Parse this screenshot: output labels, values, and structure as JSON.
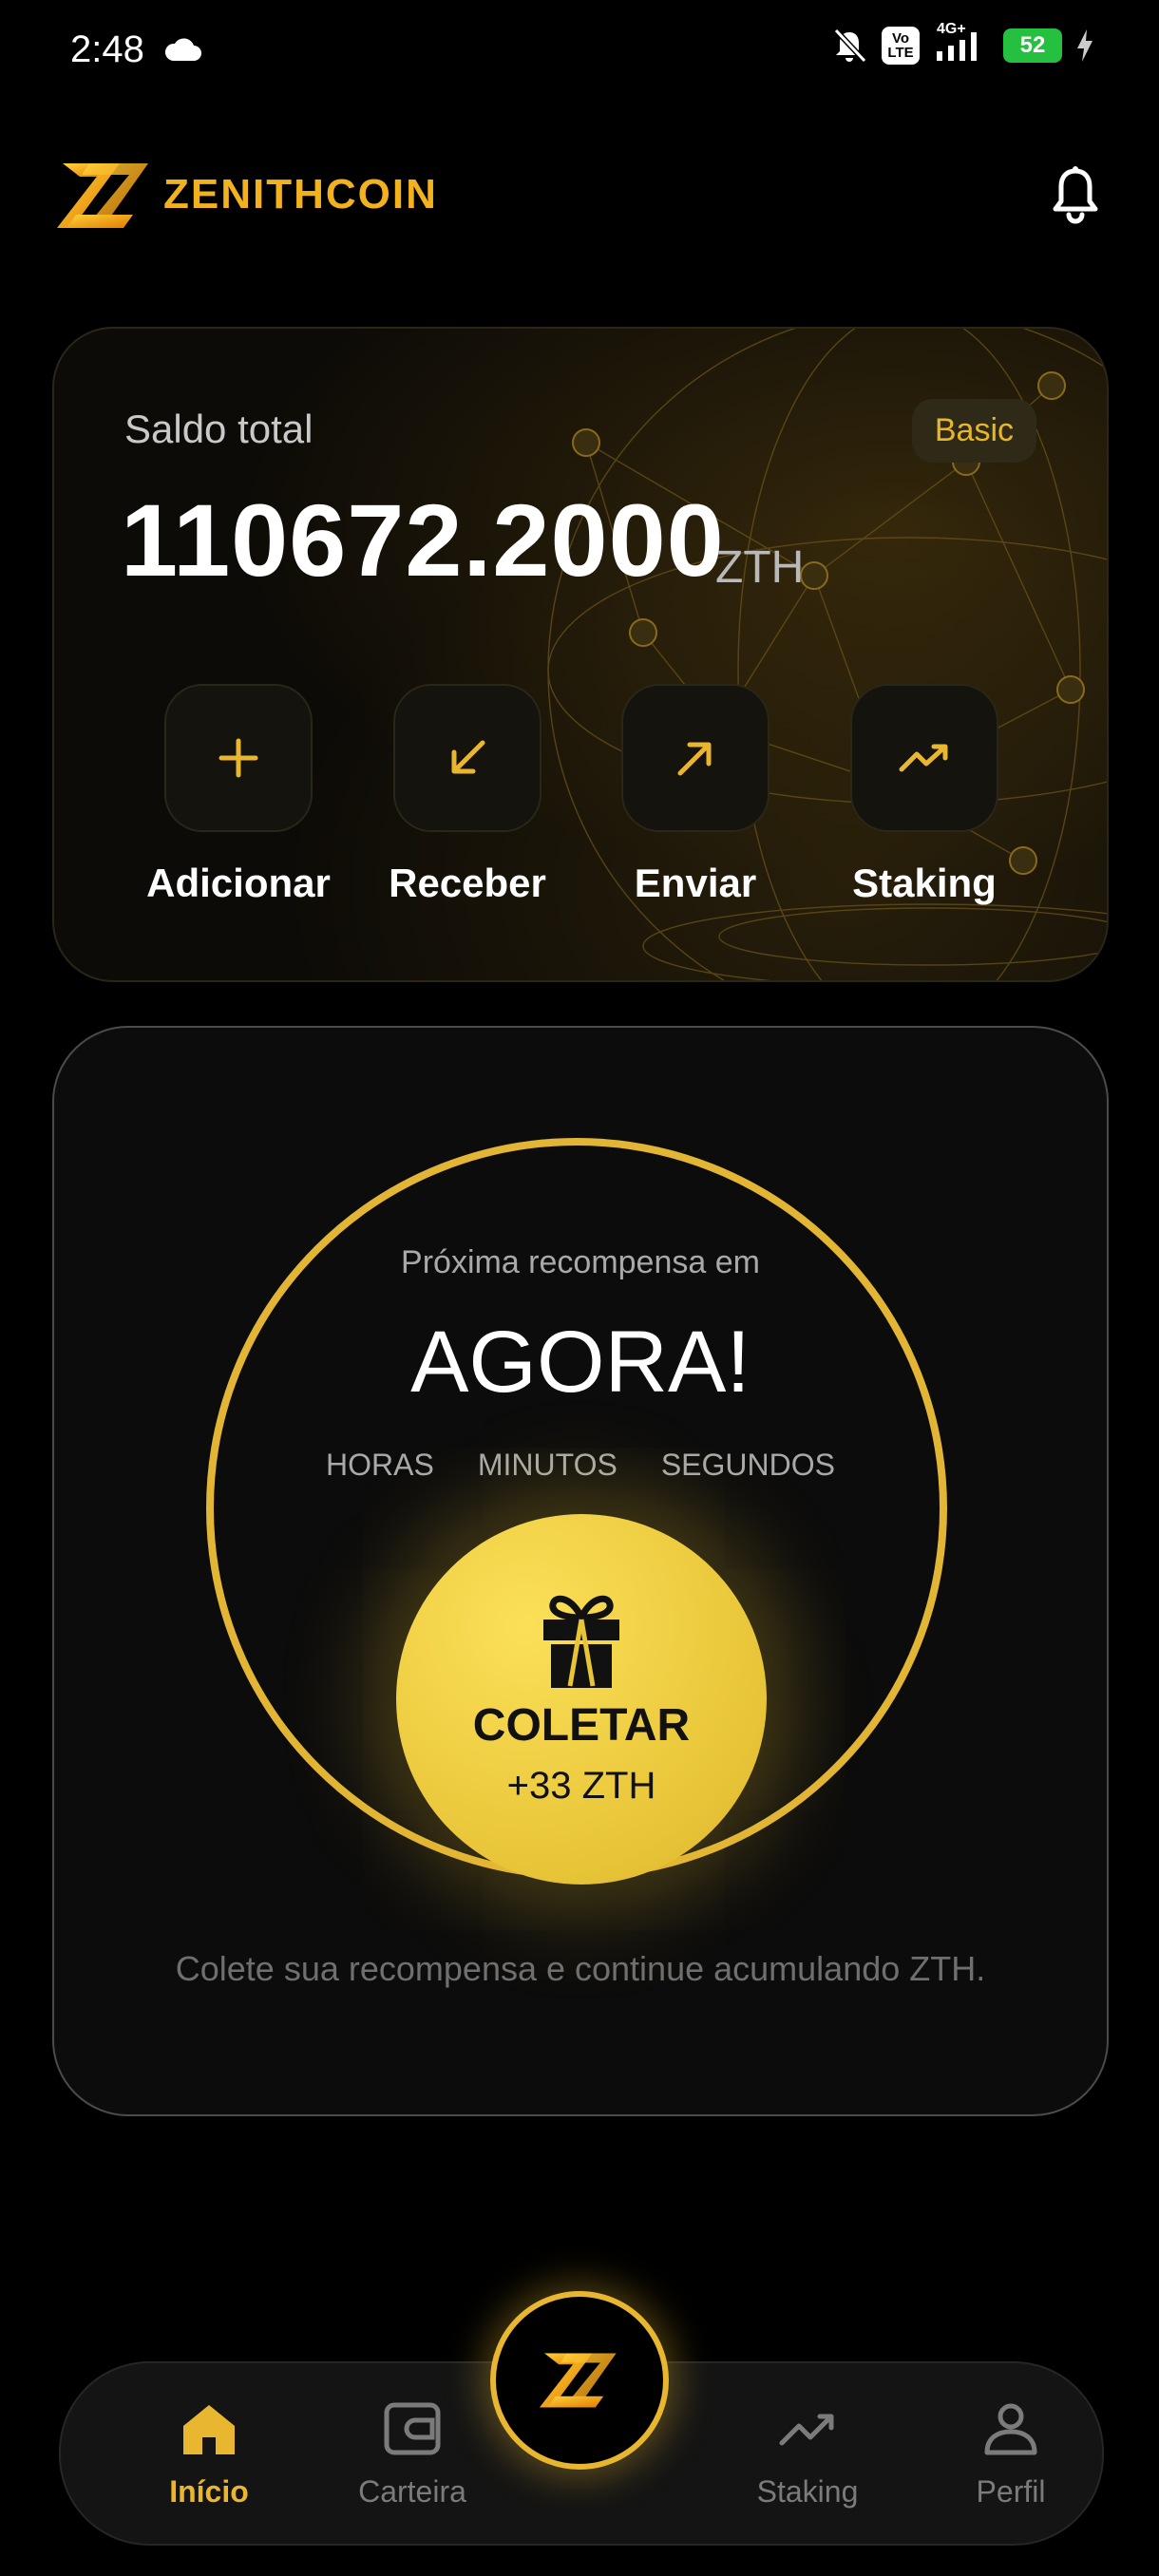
{
  "status_bar": {
    "time": "2:48",
    "network": "4G+",
    "volte_top": "Vo",
    "volte_bottom": "LTE",
    "battery": "52"
  },
  "header": {
    "brand": "ZENITHCOIN",
    "logo_icon": "zenithcoin-logo-icon",
    "notification_icon": "bell-icon"
  },
  "balance_card": {
    "label": "Saldo total",
    "plan": "Basic",
    "value": "110672.2000",
    "unit": "ZTH",
    "actions": [
      {
        "label": "Adicionar",
        "icon": "plus-icon"
      },
      {
        "label": "Receber",
        "icon": "arrow-down-left-icon"
      },
      {
        "label": "Enviar",
        "icon": "arrow-up-right-icon"
      },
      {
        "label": "Staking",
        "icon": "trend-up-icon"
      }
    ]
  },
  "reward_card": {
    "next_label": "Próxima recompensa em",
    "countdown": "AGORA!",
    "units": [
      "HORAS",
      "MINUTOS",
      "SEGUNDOS"
    ],
    "collect_label": "COLETAR",
    "collect_amount": "+33 ZTH",
    "hint": "Colete sua recompensa e continue acumulando ZTH."
  },
  "bottom_nav": {
    "items": [
      {
        "label": "Início",
        "icon": "home-icon",
        "active": true
      },
      {
        "label": "Carteira",
        "icon": "wallet-icon",
        "active": false
      },
      {
        "label": "Staking",
        "icon": "trend-up-icon",
        "active": false
      },
      {
        "label": "Perfil",
        "icon": "user-icon",
        "active": false
      }
    ],
    "center_icon": "zenithcoin-logo-icon"
  },
  "colors": {
    "accent": "#e9b630",
    "background": "#000000",
    "collect": "#f0cf3f"
  }
}
